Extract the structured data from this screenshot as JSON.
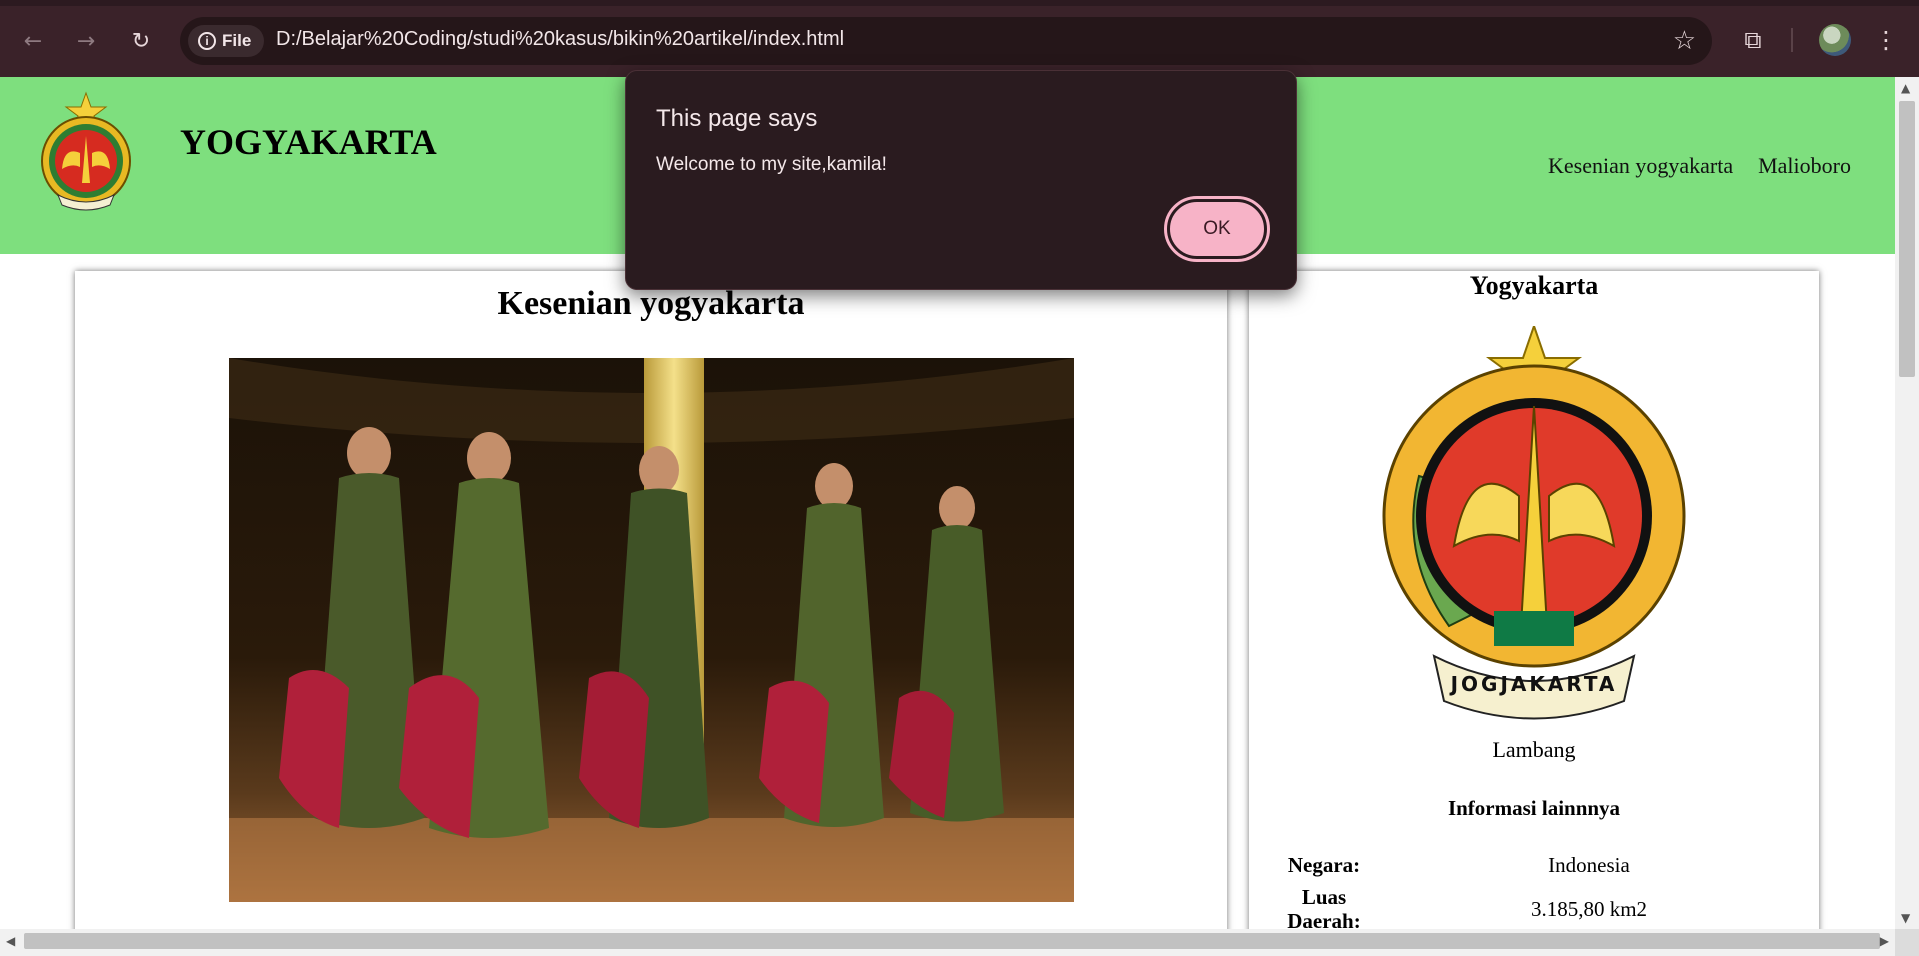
{
  "browser": {
    "back_icon": "←",
    "forward_icon": "→",
    "reload_icon": "↻",
    "file_label": "File",
    "url": "D:/Belajar%20Coding/studi%20kasus/bikin%20artikel/index.html",
    "star_icon": "☆",
    "extension_icon": "⧉",
    "menu_icon": "⋮"
  },
  "site": {
    "title": "YOGYAKARTA",
    "nav": [
      "Kesenian yogyakarta",
      "Malioboro"
    ]
  },
  "article": {
    "heading": "Kesenian yogyakarta"
  },
  "sidebar": {
    "title": "Yogyakarta",
    "emblem_text": "JOGJAKARTA",
    "caption": "Lambang",
    "info_heading": "Informasi lainnnya",
    "rows": [
      {
        "label": "Negara:",
        "value": "Indonesia"
      },
      {
        "label": "Luas Daerah:",
        "value": "3.185,80 km2"
      }
    ]
  },
  "dialog": {
    "title": "This page says",
    "message": "Welcome to my site,kamila!",
    "ok_label": "OK"
  },
  "colors": {
    "header_bg": "#7edf7e",
    "chrome_bg": "#3a2229",
    "dialog_bg": "#2a1b1f",
    "ok_button": "#f7b3c7"
  }
}
